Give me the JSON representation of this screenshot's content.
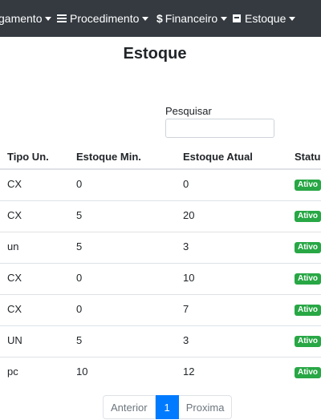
{
  "navbar": {
    "items": [
      {
        "label": "gamento",
        "icon": "",
        "dropdown": true
      },
      {
        "label": "Procedimento",
        "icon": "list-icon",
        "dropdown": true
      },
      {
        "label": "Financeiro",
        "icon": "dollar-icon",
        "icon_glyph": "$",
        "dropdown": true
      },
      {
        "label": "Estoque",
        "icon": "box-icon",
        "dropdown": true
      }
    ]
  },
  "page": {
    "title": "Estoque"
  },
  "search": {
    "label": "Pesquisar",
    "value": "",
    "placeholder": ""
  },
  "table": {
    "columns": [
      "Tipo Un.",
      "Estoque Min.",
      "Estoque Atual",
      "Status"
    ],
    "rows": [
      {
        "tipo": "CX",
        "min": "0",
        "atual": "0",
        "status": "Ativo"
      },
      {
        "tipo": "CX",
        "min": "5",
        "atual": "20",
        "status": "Ativo"
      },
      {
        "tipo": "un",
        "min": "5",
        "atual": "3",
        "status": "Ativo"
      },
      {
        "tipo": "CX",
        "min": "0",
        "atual": "10",
        "status": "Ativo"
      },
      {
        "tipo": "CX",
        "min": "0",
        "atual": "7",
        "status": "Ativo"
      },
      {
        "tipo": "UN",
        "min": "5",
        "atual": "3",
        "status": "Ativo"
      },
      {
        "tipo": "pc",
        "min": "10",
        "atual": "12",
        "status": "Ativo"
      }
    ]
  },
  "pagination": {
    "prev": "Anterior",
    "current": "1",
    "next": "Proxima"
  },
  "colors": {
    "navbar": "#343a40",
    "badge": "#28a745",
    "active_page": "#007bff"
  }
}
